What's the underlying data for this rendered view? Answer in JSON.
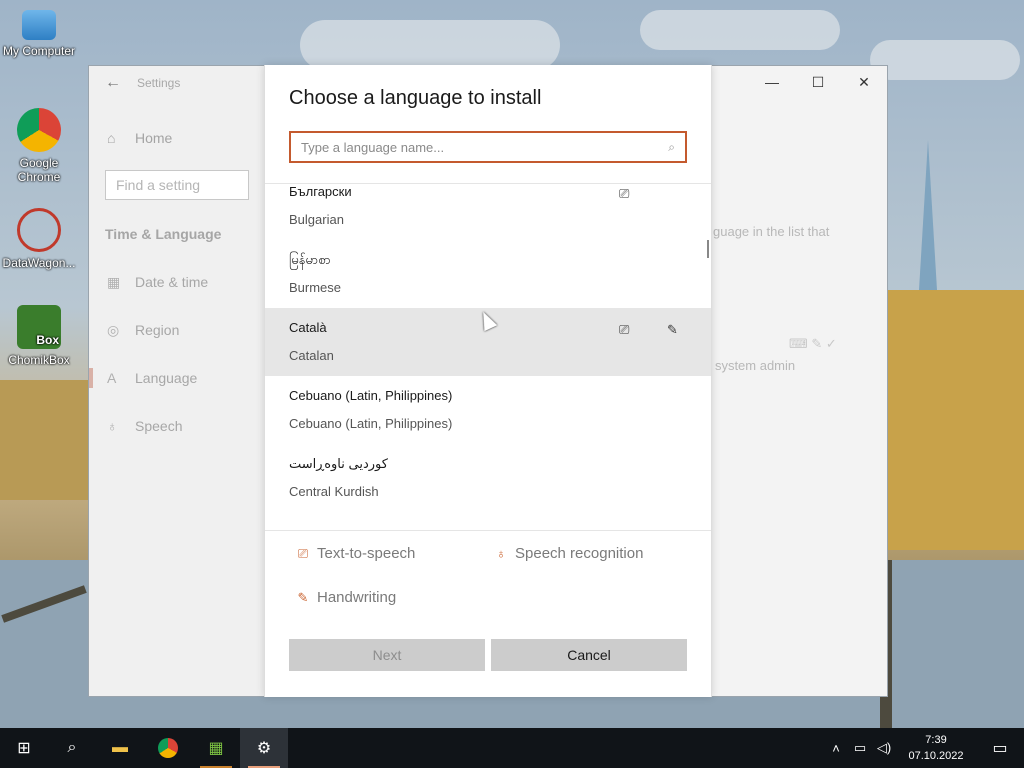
{
  "desktop": {
    "icons": [
      {
        "label": "My Computer"
      },
      {
        "label": "Google Chrome"
      },
      {
        "label": "DataWagon..."
      },
      {
        "label": "ChomikBox",
        "badge": "Box"
      }
    ]
  },
  "settings": {
    "title": "Settings",
    "home": "Home",
    "search_placeholder": "Find a setting",
    "section": "Time & Language",
    "nav": [
      {
        "label": "Date & time",
        "icon": "calendar-icon"
      },
      {
        "label": "Region",
        "icon": "globe-icon"
      },
      {
        "label": "Language",
        "icon": "language-icon",
        "active": true
      },
      {
        "label": "Speech",
        "icon": "microphone-icon"
      }
    ],
    "bg_text_1": "guage in the list that",
    "bg_text_2": "r system admin"
  },
  "dialog": {
    "title": "Choose a language to install",
    "search_placeholder": "Type a language name...",
    "languages": [
      {
        "native": "Български",
        "english": "Bulgarian",
        "features": [
          "text-to-speech-icon"
        ]
      },
      {
        "native": "မြန်မာစာ",
        "english": "Burmese",
        "features": []
      },
      {
        "native": "Català",
        "english": "Catalan",
        "features": [
          "text-to-speech-icon",
          "handwriting-icon"
        ],
        "selected": true
      },
      {
        "native": "Cebuano (Latin, Philippines)",
        "english": "Cebuano (Latin, Philippines)",
        "features": []
      },
      {
        "native": "کوردیی ناوەڕاست",
        "english": "Central Kurdish",
        "features": []
      }
    ],
    "features": {
      "tts": "Text-to-speech",
      "speech": "Speech recognition",
      "handwriting": "Handwriting"
    },
    "next_label": "Next",
    "cancel_label": "Cancel"
  },
  "taskbar": {
    "time": "7:39",
    "date": "07.10.2022"
  },
  "colors": {
    "accent": "#c45a2e",
    "taskbar": "#101418"
  }
}
